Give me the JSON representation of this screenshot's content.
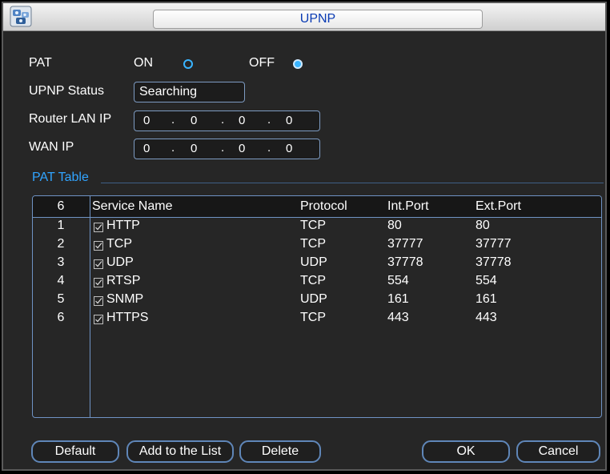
{
  "window": {
    "title": "UPNP",
    "app_icon": "camera-group-icon"
  },
  "pat": {
    "label": "PAT",
    "on_label": "ON",
    "off_label": "OFF",
    "selected": "OFF"
  },
  "upnp_status": {
    "label": "UPNP Status",
    "value": "Searching"
  },
  "router_lan_ip": {
    "label": "Router LAN IP",
    "octets": [
      "0",
      "0",
      "0",
      "0"
    ]
  },
  "wan_ip": {
    "label": "WAN IP",
    "octets": [
      "0",
      "0",
      "0",
      "0"
    ]
  },
  "pat_table": {
    "title": "PAT Table",
    "count": "6",
    "columns": [
      "Service Name",
      "Protocol",
      "Int.Port",
      "Ext.Port"
    ],
    "rows": [
      {
        "index": "1",
        "checked": true,
        "service": "HTTP",
        "protocol": "TCP",
        "int_port": "80",
        "ext_port": "80"
      },
      {
        "index": "2",
        "checked": true,
        "service": "TCP",
        "protocol": "TCP",
        "int_port": "37777",
        "ext_port": "37777"
      },
      {
        "index": "3",
        "checked": true,
        "service": "UDP",
        "protocol": "UDP",
        "int_port": "37778",
        "ext_port": "37778"
      },
      {
        "index": "4",
        "checked": true,
        "service": "RTSP",
        "protocol": "TCP",
        "int_port": "554",
        "ext_port": "554"
      },
      {
        "index": "5",
        "checked": true,
        "service": "SNMP",
        "protocol": "UDP",
        "int_port": "161",
        "ext_port": "161"
      },
      {
        "index": "6",
        "checked": true,
        "service": "HTTPS",
        "protocol": "TCP",
        "int_port": "443",
        "ext_port": "443"
      }
    ]
  },
  "buttons": {
    "default": "Default",
    "add_to_list": "Add to the List",
    "delete": "Delete",
    "ok": "OK",
    "cancel": "Cancel"
  },
  "colors": {
    "accent": "#39b4ff",
    "border": "#6f93c4",
    "title_text": "#0a3bb3",
    "background": "#262626"
  }
}
